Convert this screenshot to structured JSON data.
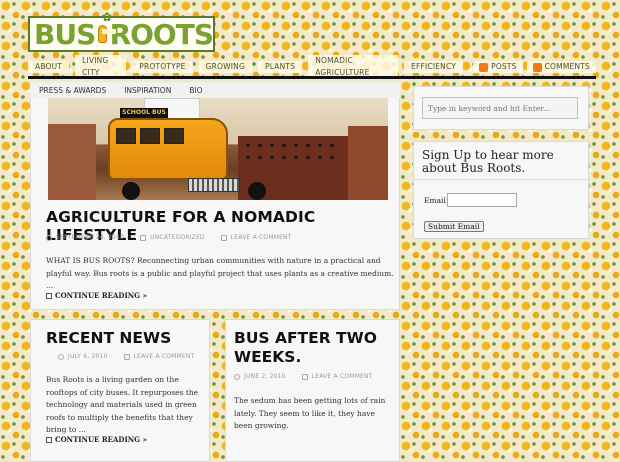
{
  "logo": {
    "left_text": "BUS",
    "right_text": "ROOTS"
  },
  "topnav": {
    "items": [
      "ABOUT",
      "LIVING CITY",
      "PROTOTYPE",
      "GROWING",
      "PLANTS",
      "NOMADIC AGRICULTURE",
      "EFFICIENCY"
    ],
    "posts_label": "POSTS",
    "comments_label": "COMMENTS"
  },
  "subnav": {
    "items": [
      "PRESS & AWARDS",
      "INSPIRATION",
      "BIO"
    ]
  },
  "image": {
    "bus_sign": "SCHOOL BUS"
  },
  "main_post": {
    "title": "AGRICULTURE FOR A NOMADIC LIFESTYLE",
    "date": "SEPTEMBER 24, 2010",
    "category": "UNCATEGORIZED",
    "comment": "LEAVE A COMMENT",
    "excerpt": "WHAT IS BUS ROOTS? Reconnecting urban communities with nature in a practical and playful way. Bus roots is a public and playful project that uses plants as a creative medium. ...",
    "more": "CONTINUE READING »"
  },
  "sidebar": {
    "search_placeholder": "Type in keyword and hit Enter...",
    "signup_title": "Sign Up to hear more about Bus Roots.",
    "email_label": "Email:",
    "submit_label": "Submit Email"
  },
  "news_post": {
    "title": "RECENT NEWS",
    "date": "JULY 6, 2010",
    "comment": "LEAVE A COMMENT",
    "excerpt": "Bus Roots is a living garden on the rooftops of city buses. It repurposes the technology and materials used in green roofs to multiply the benefits that they bring to ...",
    "more": "CONTINUE READING »"
  },
  "bus_post": {
    "title": "BUS AFTER TWO WEEKS.",
    "date": "JUNE 2, 2010",
    "comment": "LEAVE A COMMENT",
    "excerpt": "The sedum has been getting lots of rain lately.  They seem to like it,  they have been growing."
  },
  "colors": {
    "accent_yellow": "#f2b51c",
    "logo_green": "#7aa22f",
    "rss_orange": "#f07a1a"
  }
}
